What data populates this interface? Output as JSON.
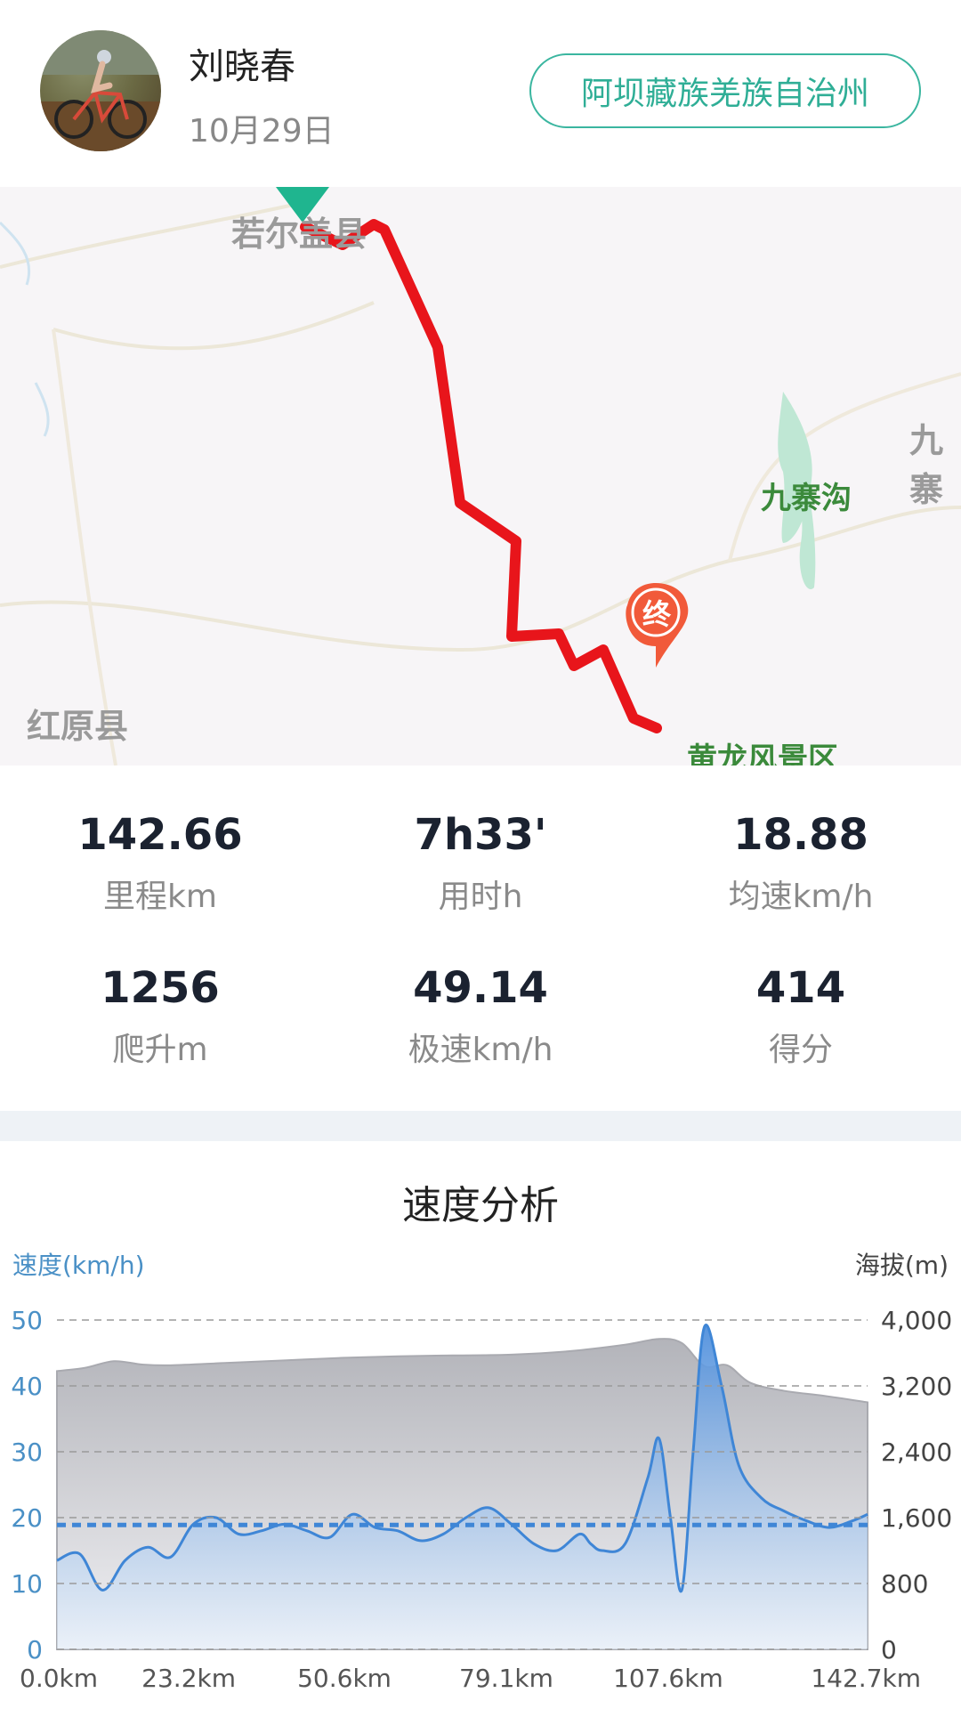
{
  "header": {
    "user_name": "刘晓春",
    "date": "10月29日",
    "region": "阿坝藏族羌族自治州",
    "avatar_icon": "cyclist-photo"
  },
  "map": {
    "labels": {
      "ruoer": "若尔盖县",
      "hongyuan": "红原县",
      "jiuzhaigou": "九寨沟",
      "jiu": "九寨",
      "huanglong": "黄龙风景区"
    },
    "end_marker": "终",
    "route_color": "#e8151b",
    "start_marker_color": "#1fb58f",
    "end_marker_color": "#f15a3a"
  },
  "stats": [
    {
      "value": "142.66",
      "label": "里程km"
    },
    {
      "value": "7h33'",
      "label": "用时h"
    },
    {
      "value": "18.88",
      "label": "均速km/h"
    },
    {
      "value": "1256",
      "label": "爬升m"
    },
    {
      "value": "49.14",
      "label": "极速km/h"
    },
    {
      "value": "414",
      "label": "得分"
    }
  ],
  "chart": {
    "title": "速度分析",
    "left_axis_title": "速度(km/h)",
    "right_axis_title": "海拔(m)",
    "left_ticks": [
      "0",
      "10",
      "20",
      "30",
      "40",
      "50"
    ],
    "right_ticks": [
      "0",
      "800",
      "1,600",
      "2,400",
      "3,200",
      "4,000"
    ],
    "x_ticks": [
      "0.0km",
      "23.2km",
      "50.6km",
      "79.1km",
      "107.6km",
      "142.7km"
    ]
  },
  "chart_data": {
    "type": "area",
    "xlabel": "",
    "ylabel": "速度(km/h)",
    "y2label": "海拔(m)",
    "xlim": [
      0,
      142.7
    ],
    "ylim": [
      0,
      50
    ],
    "y2lim": [
      0,
      4000
    ],
    "grid": true,
    "average_speed": 18.88,
    "x_ticks": [
      0.0,
      23.2,
      50.6,
      79.1,
      107.6,
      142.7
    ],
    "series": [
      {
        "name": "速度",
        "axis": "left",
        "color": "#4a90d9",
        "x": [
          0,
          4,
          8,
          12,
          16,
          20,
          24,
          28,
          32,
          36,
          40,
          44,
          48,
          52,
          56,
          60,
          64,
          68,
          72,
          76,
          80,
          84,
          88,
          92,
          94,
          96,
          100,
          104,
          106,
          108,
          110,
          112,
          114,
          117,
          120,
          124,
          128,
          132,
          136,
          140,
          142.7
        ],
        "y": [
          13.5,
          14.5,
          9,
          13.5,
          15.5,
          14,
          19,
          20,
          17.5,
          18,
          19,
          18,
          17,
          20.5,
          18.5,
          18,
          16.5,
          17.5,
          20,
          21.5,
          19,
          16,
          15,
          17.5,
          16,
          15,
          16,
          26,
          32,
          20,
          9,
          30,
          49,
          40,
          28,
          23,
          21,
          19.5,
          18.5,
          19.5,
          20.5
        ]
      },
      {
        "name": "海拔",
        "axis": "right",
        "color": "#b9babf",
        "x": [
          0,
          5,
          10,
          15,
          20,
          30,
          40,
          50,
          60,
          70,
          80,
          90,
          100,
          106,
          110,
          114,
          118,
          122,
          128,
          135,
          142.7
        ],
        "y": [
          3380,
          3420,
          3500,
          3460,
          3450,
          3480,
          3510,
          3540,
          3560,
          3570,
          3580,
          3620,
          3700,
          3770,
          3720,
          3440,
          3450,
          3240,
          3140,
          3080,
          3000
        ]
      }
    ]
  }
}
